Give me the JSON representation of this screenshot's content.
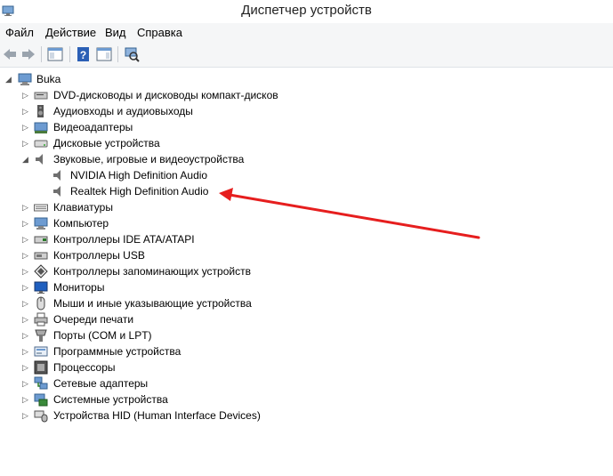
{
  "window": {
    "title": "Диспетчер устройств"
  },
  "menu": {
    "file": "Файл",
    "action": "Действие",
    "view": "Вид",
    "help": "Справка"
  },
  "tree": {
    "root": "Buka",
    "cat_dvd": "DVD-дисководы и дисководы компакт-дисков",
    "cat_audio_io": "Аудиовходы и аудиовыходы",
    "cat_video": "Видеоадаптеры",
    "cat_disks": "Дисковые устройства",
    "cat_sound": "Звуковые, игровые и видеоустройства",
    "dev_nvidia": "NVIDIA High Definition Audio",
    "dev_realtek": "Realtek High Definition Audio",
    "cat_keyboards": "Клавиатуры",
    "cat_computer": "Компьютер",
    "cat_ide": "Контроллеры IDE ATA/ATAPI",
    "cat_usb": "Контроллеры USB",
    "cat_storage": "Контроллеры запоминающих устройств",
    "cat_monitors": "Мониторы",
    "cat_mice": "Мыши и иные указывающие устройства",
    "cat_print": "Очереди печати",
    "cat_ports": "Порты (COM и LPT)",
    "cat_software": "Программные устройства",
    "cat_cpu": "Процессоры",
    "cat_net": "Сетевые адаптеры",
    "cat_system": "Системные устройства",
    "cat_hid": "Устройства HID (Human Interface Devices)"
  },
  "colors": {
    "accent": "#e61e1e",
    "selection": "#cce8ff"
  }
}
